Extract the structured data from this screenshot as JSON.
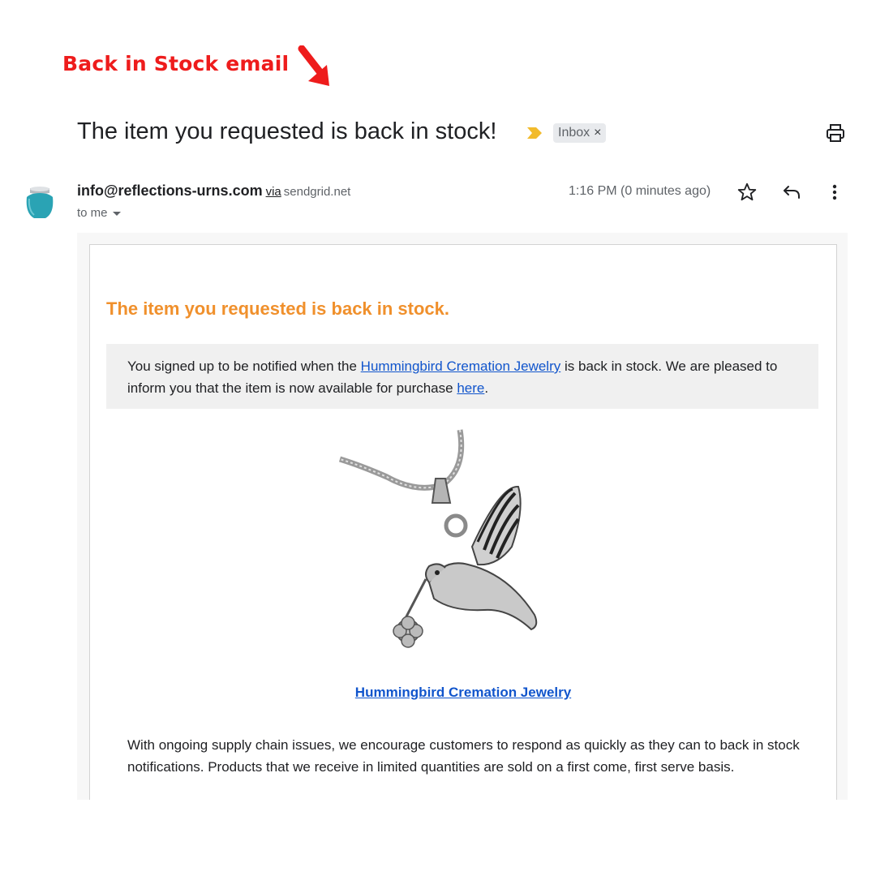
{
  "annotation": {
    "label": "Back in Stock email",
    "color": "#ee1c1c"
  },
  "email": {
    "subject": "The item you requested is back in stock!",
    "label_chip": "Inbox",
    "label_chip_close": "×",
    "sender_email": "info@reflections-urns.com",
    "via_text": "via",
    "via_domain": "sendgrid.net",
    "recipient": "to me",
    "time": "1:16 PM (0 minutes ago)",
    "icons": [
      "importance-marker-icon",
      "print-icon",
      "star-icon",
      "reply-icon",
      "more-options-icon",
      "urn-avatar-icon"
    ]
  },
  "body": {
    "heading": "The item you requested is back in stock.",
    "heading_color": "#f0902c",
    "notice_part1": "You signed up to be notified when the",
    "product_link": "Hummingbird Cremation Jewelry",
    "notice_part2": "is back in stock. We are pleased to inform you that the item is now available for purchase",
    "here_link": "here",
    "notice_end": ".",
    "product_caption": "Hummingbird Cremation Jewelry",
    "paragraph": "With ongoing supply chain issues, we encourage customers to respond as quickly as they can to back in stock notifications. Products that we receive in limited quantities are sold on a first come, first serve basis.",
    "link_color": "#1155cc"
  }
}
